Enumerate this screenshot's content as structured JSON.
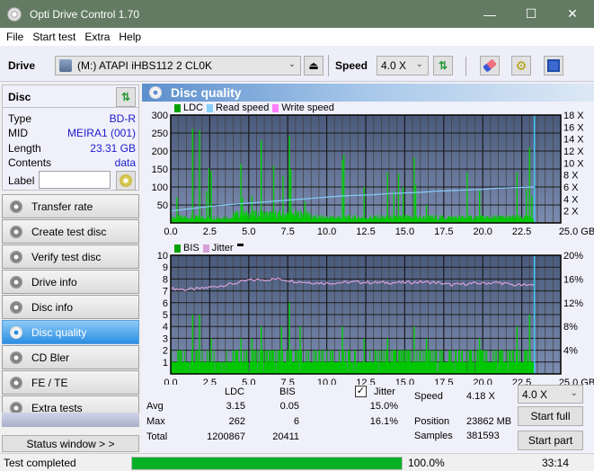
{
  "window": {
    "title": "Opti Drive Control 1.70",
    "controls": [
      "minimize",
      "maximize",
      "close"
    ]
  },
  "menu": [
    "File",
    "Start test",
    "Extra",
    "Help"
  ],
  "toolbar": {
    "drive_label": "Drive",
    "drive_value": "(M:)  ATAPI iHBS112  2 CL0K",
    "speed_label": "Speed",
    "speed_value": "4.0 X",
    "icons": [
      "eject-icon",
      "refresh-icon",
      "erase-icon",
      "settings-icon",
      "save-icon"
    ]
  },
  "disc": {
    "header": "Disc",
    "props": [
      {
        "k": "Type",
        "v": "BD-R"
      },
      {
        "k": "MID",
        "v": "MEIRA1 (001)"
      },
      {
        "k": "Length",
        "v": "23.31 GB"
      },
      {
        "k": "Contents",
        "v": "data"
      }
    ],
    "label_key": "Label",
    "label_value": ""
  },
  "nav": [
    {
      "label": "Transfer rate",
      "active": false
    },
    {
      "label": "Create test disc",
      "active": false
    },
    {
      "label": "Verify test disc",
      "active": false
    },
    {
      "label": "Drive info",
      "active": false
    },
    {
      "label": "Disc info",
      "active": false
    },
    {
      "label": "Disc quality",
      "active": true
    },
    {
      "label": "CD Bler",
      "active": false
    },
    {
      "label": "FE / TE",
      "active": false
    },
    {
      "label": "Extra tests",
      "active": false
    }
  ],
  "status_window_btn": "Status window > >",
  "panel_title": "Disc quality",
  "chart_data": [
    {
      "type": "bar",
      "title": "LDC",
      "legend": [
        "LDC",
        "Read speed",
        "Write speed"
      ],
      "colors": {
        "LDC": "#00c000",
        "Read speed": "#87cefa",
        "Write speed": "#ff80ff"
      },
      "xlabel": "GB",
      "x_ticks": [
        "0.0",
        "2.5",
        "5.0",
        "7.5",
        "10.0",
        "12.5",
        "15.0",
        "17.5",
        "20.0",
        "22.5",
        "25.0 GB"
      ],
      "xlim": [
        0,
        25
      ],
      "y_ticks": [
        "300",
        "250",
        "200",
        "150",
        "100",
        "50"
      ],
      "ylim": [
        0,
        300
      ],
      "y2_ticks": [
        "18 X",
        "16 X",
        "14 X",
        "12 X",
        "10 X",
        "8 X",
        "6 X",
        "4 X",
        "2 X"
      ],
      "y2lim": [
        0,
        18
      ],
      "end_marker_gb": 23.31,
      "ldc_spikes": [
        [
          0.4,
          72
        ],
        [
          1.4,
          262
        ],
        [
          1.85,
          258
        ],
        [
          2.45,
          152
        ],
        [
          2.6,
          145
        ],
        [
          2.3,
          88
        ],
        [
          4.5,
          165
        ],
        [
          4.6,
          70
        ],
        [
          5.2,
          75
        ],
        [
          5.8,
          230
        ],
        [
          6.6,
          160
        ],
        [
          7.2,
          130
        ],
        [
          7.6,
          242
        ],
        [
          7.7,
          150
        ],
        [
          8.6,
          60
        ],
        [
          11.0,
          175
        ],
        [
          11.1,
          190
        ],
        [
          12.4,
          100
        ],
        [
          13.9,
          140
        ],
        [
          14.3,
          88
        ],
        [
          14.6,
          138
        ],
        [
          14.9,
          100
        ],
        [
          15.6,
          182
        ],
        [
          15.7,
          105
        ],
        [
          16.4,
          50
        ],
        [
          19.0,
          140
        ],
        [
          19.8,
          90
        ],
        [
          22.2,
          140
        ],
        [
          22.8,
          95
        ],
        [
          23.0,
          210
        ],
        [
          23.15,
          75
        ]
      ],
      "ldc_baseline": 15,
      "read_speed": [
        [
          0,
          2.0
        ],
        [
          1,
          2.3
        ],
        [
          2,
          2.6
        ],
        [
          3,
          2.9
        ],
        [
          4,
          3.1
        ],
        [
          5,
          3.3
        ],
        [
          6,
          3.5
        ],
        [
          7,
          3.7
        ],
        [
          8,
          3.9
        ],
        [
          9,
          4.1
        ],
        [
          10,
          4.3
        ],
        [
          11,
          4.5
        ],
        [
          12,
          4.6
        ],
        [
          13,
          4.7
        ],
        [
          14,
          4.9
        ],
        [
          15,
          5.0
        ],
        [
          16,
          5.1
        ],
        [
          17,
          5.3
        ],
        [
          18,
          5.4
        ],
        [
          19,
          5.5
        ],
        [
          20,
          5.6
        ],
        [
          21,
          5.8
        ],
        [
          22,
          5.9
        ],
        [
          23.3,
          6.0
        ]
      ]
    },
    {
      "type": "bar",
      "title": "BIS",
      "legend": [
        "BIS",
        "Jitter"
      ],
      "colors": {
        "BIS": "#00c000",
        "Jitter": "#d8a0d8"
      },
      "x_ticks": [
        "0.0",
        "2.5",
        "5.0",
        "7.5",
        "10.0",
        "12.5",
        "15.0",
        "17.5",
        "20.0",
        "22.5",
        "25.0 GB"
      ],
      "xlim": [
        0,
        25
      ],
      "y_ticks": [
        "10",
        "9",
        "8",
        "7",
        "6",
        "5",
        "4",
        "3",
        "2",
        "1"
      ],
      "ylim": [
        0,
        10
      ],
      "y2_ticks": [
        "20%",
        "16%",
        "12%",
        "8%",
        "4%"
      ],
      "y2lim": [
        0,
        20
      ],
      "end_marker_gb": 23.31,
      "bis_spikes": [
        [
          1.4,
          5
        ],
        [
          1.85,
          5
        ],
        [
          2.6,
          3
        ],
        [
          4.5,
          3
        ],
        [
          5.2,
          3
        ],
        [
          5.8,
          4
        ],
        [
          7.1,
          4
        ],
        [
          7.6,
          6
        ],
        [
          8.3,
          4
        ],
        [
          11.0,
          4
        ],
        [
          12.4,
          3
        ],
        [
          13.9,
          3
        ],
        [
          15.6,
          4
        ],
        [
          16.4,
          3
        ],
        [
          19.8,
          3
        ],
        [
          22.2,
          4
        ],
        [
          23.0,
          5
        ]
      ],
      "jitter": [
        [
          0,
          14.4
        ],
        [
          1,
          14.2
        ],
        [
          2,
          14.4
        ],
        [
          3,
          14.8
        ],
        [
          4,
          15.2
        ],
        [
          5,
          15.8
        ],
        [
          6,
          15.9
        ],
        [
          7,
          16.0
        ],
        [
          8,
          15.6
        ],
        [
          9,
          15.4
        ],
        [
          10,
          15.3
        ],
        [
          11,
          15.4
        ],
        [
          12,
          15.5
        ],
        [
          13,
          15.4
        ],
        [
          14,
          15.4
        ],
        [
          15,
          15.4
        ],
        [
          16,
          15.5
        ],
        [
          17,
          15.4
        ],
        [
          18,
          15.0
        ],
        [
          19,
          15.2
        ],
        [
          20,
          15.3
        ],
        [
          21,
          15.4
        ],
        [
          22,
          15.0
        ],
        [
          23.3,
          14.9
        ]
      ]
    }
  ],
  "stats": {
    "col_ldc": "LDC",
    "col_bis": "BIS",
    "jitter_label": "Jitter",
    "jitter_checked": true,
    "rows": [
      {
        "label": "Avg",
        "ldc": "3.15",
        "bis": "0.05",
        "jitter": "15.0%"
      },
      {
        "label": "Max",
        "ldc": "262",
        "bis": "6",
        "jitter": "16.1%"
      },
      {
        "label": "Total",
        "ldc": "1200867",
        "bis": "20411",
        "jitter": ""
      }
    ],
    "speed_label": "Speed",
    "speed_value": "4.18 X",
    "position_label": "Position",
    "position_value": "23862 MB",
    "samples_label": "Samples",
    "samples_value": "381593",
    "speed_select": "4.0 X",
    "start_full": "Start full",
    "start_part": "Start part"
  },
  "status": {
    "text": "Test completed",
    "progress": 100.0,
    "progress_text": "100.0%",
    "time": "33:14"
  }
}
